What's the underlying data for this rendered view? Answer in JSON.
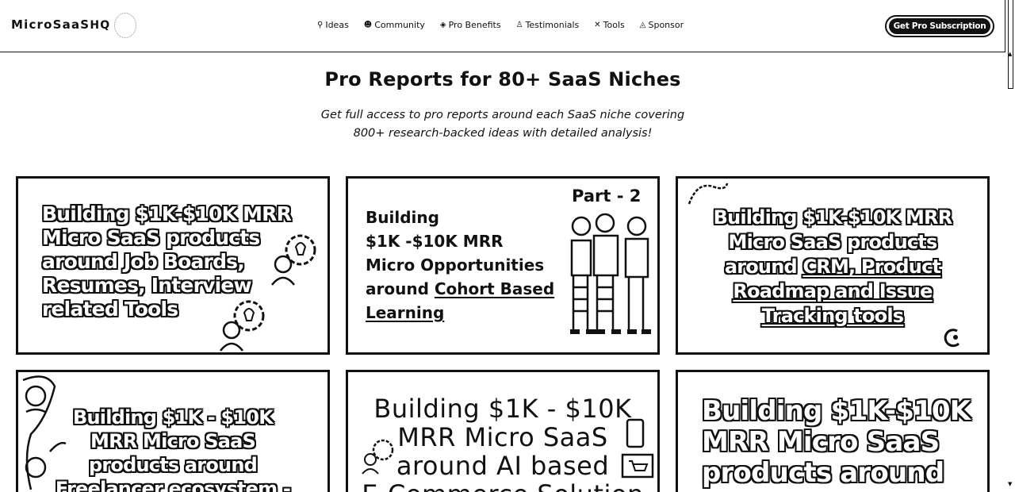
{
  "header": {
    "logo_main": "MicroSaaS",
    "logo_suffix": "HQ",
    "nav": [
      {
        "icon": "bulb-icon",
        "glyph": "💡",
        "label": "Ideas"
      },
      {
        "icon": "users-icon",
        "glyph": "👥",
        "label": "Community"
      },
      {
        "icon": "diamond-icon",
        "glyph": "💎",
        "label": "Pro Benefits"
      },
      {
        "icon": "quote-icon",
        "glyph": "🗨",
        "label": "Testimonials"
      },
      {
        "icon": "tools-icon",
        "glyph": "✂",
        "label": "Tools"
      },
      {
        "icon": "handshake-icon",
        "glyph": "🤝",
        "label": "Sponsor"
      }
    ],
    "cta_label": "Get Pro Subscription"
  },
  "hero": {
    "title": "Pro Reports for 80+ SaaS Niches",
    "subtitle_line1": "Get full access to pro reports around each SaaS niche covering",
    "subtitle_line2": "800+ research-backed ideas with detailed analysis!"
  },
  "cards": [
    {
      "lines": [
        "Building $1K-$10K MRR",
        "Micro SaaS products",
        "around Job Boards,",
        "Resumes, Interview",
        "related Tools"
      ]
    },
    {
      "part": "Part - 2",
      "lines": [
        "Building",
        "$1K -$10K MRR",
        "Micro Opportunities"
      ],
      "around_prefix": "around ",
      "underlined_1": "Cohort Based",
      "underlined_2": "Learning"
    },
    {
      "lines": [
        "Building $1K-$10K MRR",
        "Micro SaaS products"
      ],
      "around_prefix": "around ",
      "underlined_1": "CRM, Product",
      "underlined_2": "Roadmap and Issue",
      "underlined_3": "Tracking tools"
    },
    {
      "lines": [
        "Building $1K - $10K",
        "MRR Micro SaaS",
        "products around",
        "Freelancer ecosystem -"
      ]
    },
    {
      "lines": [
        "Building $1K - $10K",
        "MRR Micro SaaS",
        "around AI based",
        "E-Commerce Solution"
      ]
    },
    {
      "lines": [
        "Building $1K-$10K",
        "MRR Micro SaaS",
        "products around"
      ]
    }
  ]
}
